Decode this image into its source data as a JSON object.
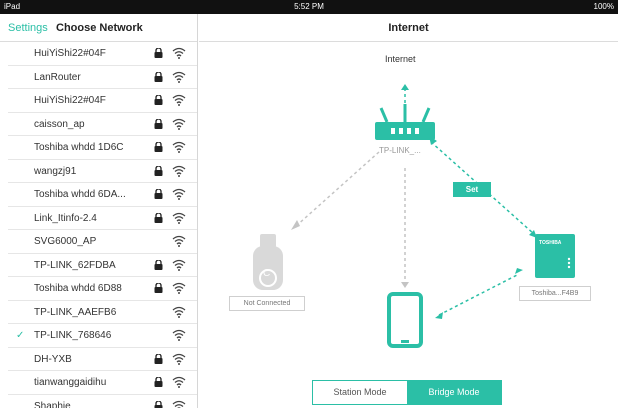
{
  "status_bar": {
    "device": "iPad",
    "time": "5:52 PM",
    "battery": "100%"
  },
  "sidebar": {
    "back_label": "Settings",
    "title": "Choose Network",
    "networks": [
      {
        "name": "HuiYiShi22#04F",
        "locked": true,
        "selected": false
      },
      {
        "name": "LanRouter",
        "locked": true,
        "selected": false
      },
      {
        "name": "HuiYiShi22#04F",
        "locked": true,
        "selected": false
      },
      {
        "name": "caisson_ap",
        "locked": true,
        "selected": false
      },
      {
        "name": "Toshiba whdd 1D6C",
        "locked": true,
        "selected": false
      },
      {
        "name": "wangzj91",
        "locked": true,
        "selected": false
      },
      {
        "name": "Toshiba whdd 6DA...",
        "locked": true,
        "selected": false
      },
      {
        "name": "Link_Itinfo-2.4",
        "locked": true,
        "selected": false
      },
      {
        "name": "SVG6000_AP",
        "locked": false,
        "selected": false
      },
      {
        "name": "TP-LINK_62FDBA",
        "locked": true,
        "selected": false
      },
      {
        "name": "Toshiba whdd 6D88",
        "locked": true,
        "selected": false
      },
      {
        "name": "TP-LINK_AAEFB6",
        "locked": false,
        "selected": false
      },
      {
        "name": "TP-LINK_768646",
        "locked": false,
        "selected": true
      },
      {
        "name": "DH-YXB",
        "locked": true,
        "selected": false
      },
      {
        "name": "tianwanggaidihu",
        "locked": true,
        "selected": false
      },
      {
        "name": "Shaphie",
        "locked": true,
        "selected": false
      }
    ],
    "check_glyph": "✓"
  },
  "main": {
    "title": "Internet",
    "internet_label": "Internet",
    "router_label": "TP-LINK_...",
    "set_label": "Set",
    "usb_label": "Not Connected",
    "toshiba_label": "Toshiba...F4B9",
    "toshiba_brand": "TOSHIBA",
    "usb_letter": "C",
    "modes": {
      "station": "Station Mode",
      "bridge": "Bridge Mode",
      "active": "bridge"
    }
  },
  "colors": {
    "accent": "#2bbfa6",
    "gray_device": "#d9d9d9",
    "dashed_gray": "#c4c4c4"
  },
  "icons": {
    "lock": "lock-icon",
    "wifi": "wifi-icon",
    "check": "checkmark-icon"
  }
}
